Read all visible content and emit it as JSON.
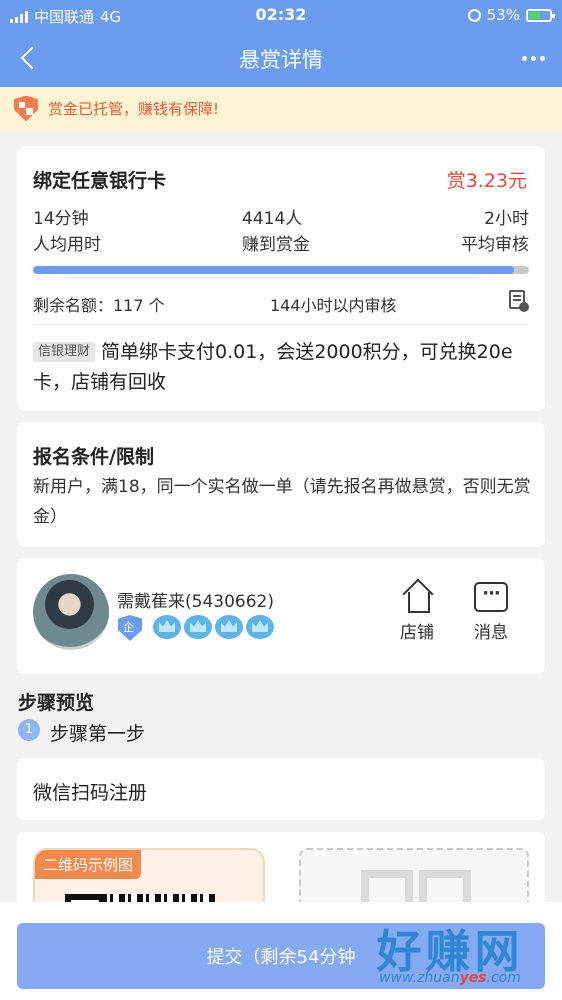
{
  "status_bar": {
    "carrier": "中国联通",
    "network": "4G",
    "time": "02:32",
    "battery_percent": "53%"
  },
  "nav": {
    "title": "悬赏详情"
  },
  "notice": {
    "text": "赏金已托管，赚钱有保障!"
  },
  "task": {
    "title": "绑定任意银行卡",
    "reward": "赏3.23元",
    "stats": [
      {
        "value": "14分钟",
        "label": "人均用时"
      },
      {
        "value": "4414人",
        "label": "赚到赏金"
      },
      {
        "value": "2小时",
        "label": "平均审核"
      }
    ],
    "progress_fraction": 0.97,
    "remaining": "剩余名额：117 个",
    "review_limit": "144小时以内审核",
    "tag": "信银理财",
    "description": "简单绑卡支付0.01，会送2000积分，可兑换20e卡，店铺有回收"
  },
  "conditions": {
    "title": "报名条件/限制",
    "body": "新用户，满18，同一个实名做一单（请先报名再做悬赏，否则无赏金）"
  },
  "publisher": {
    "name": "需戴萑来(5430662)",
    "cert_label": "企",
    "crown_count": 4,
    "shop_label": "店铺",
    "message_label": "消息"
  },
  "steps": {
    "title": "步骤预览",
    "index": "1",
    "label": "步骤第一步",
    "text": "微信扫码注册",
    "qr_tag": "二维码示例图"
  },
  "submit": {
    "label": "提交（剩余54分钟"
  },
  "watermark": {
    "title": "好赚网",
    "url_prefix": "www.zhuan",
    "url_highlight": "yes",
    "url_suffix": ".com"
  },
  "colors": {
    "primary": "#6b9cf0",
    "reward": "#e8453c",
    "notice_bg": "#fdf4d3",
    "notice_text": "#e85a3a",
    "submit": "#86a9f3"
  }
}
